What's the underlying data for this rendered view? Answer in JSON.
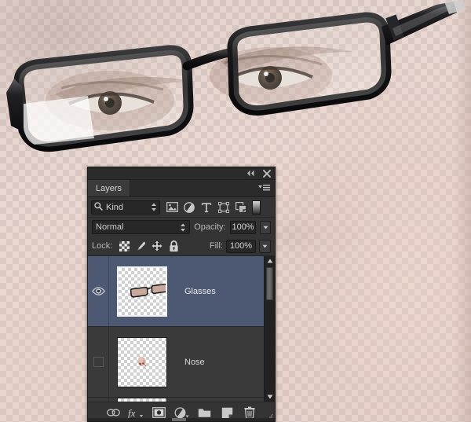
{
  "app": {
    "panel_title": "Layers"
  },
  "panel": {
    "titlebar": {
      "collapse_label": "◂◂",
      "close_label": "✕"
    },
    "tab": {
      "label": "Layers",
      "menu_icon": "panel-menu-icon"
    },
    "filter": {
      "search_icon": "search-icon",
      "kind_label": "Kind",
      "icons": [
        {
          "name": "filter-pixel-layers-icon",
          "title": "Pixel layers"
        },
        {
          "name": "filter-adjustment-layers-icon",
          "title": "Adjustment layers"
        },
        {
          "name": "filter-type-layers-icon",
          "title": "Type layers"
        },
        {
          "name": "filter-shape-layers-icon",
          "title": "Shape layers"
        },
        {
          "name": "filter-smart-object-icon",
          "title": "Smart objects"
        }
      ],
      "toggle_name": "filter-enable-toggle"
    },
    "blend": {
      "mode_value": "Normal",
      "opacity_label": "Opacity:",
      "opacity_value": "100%"
    },
    "lock": {
      "label": "Lock:",
      "icons": [
        {
          "name": "lock-transparent-pixels-icon"
        },
        {
          "name": "lock-image-pixels-icon"
        },
        {
          "name": "lock-position-icon"
        },
        {
          "name": "lock-all-icon"
        }
      ],
      "fill_label": "Fill:",
      "fill_value": "100%"
    },
    "layers": [
      {
        "name": "Glasses",
        "visible": true,
        "selected": true,
        "thumbnail": "glasses-thumbnail"
      },
      {
        "name": "Nose",
        "visible": false,
        "selected": false,
        "thumbnail": "nose-thumbnail"
      }
    ],
    "footer_buttons": [
      {
        "name": "link-layers-button",
        "glyph": "link"
      },
      {
        "name": "layer-style-fx-button",
        "glyph": "fx"
      },
      {
        "name": "add-layer-mask-button",
        "glyph": "mask"
      },
      {
        "name": "new-adjustment-layer-button",
        "glyph": "adjustment"
      },
      {
        "name": "new-group-button",
        "glyph": "folder"
      },
      {
        "name": "new-layer-button",
        "glyph": "new-layer"
      },
      {
        "name": "delete-layer-button",
        "glyph": "trash"
      }
    ]
  },
  "colors": {
    "panel_bg": "#343434",
    "panel_header_bg": "#2b2b2b",
    "row_bg": "#3a3a3a",
    "row_selected_bg": "#4d5872",
    "text": "#d8d8d8",
    "field_bg": "#272727",
    "skin": "#e2c7be",
    "frame": "#121212"
  }
}
